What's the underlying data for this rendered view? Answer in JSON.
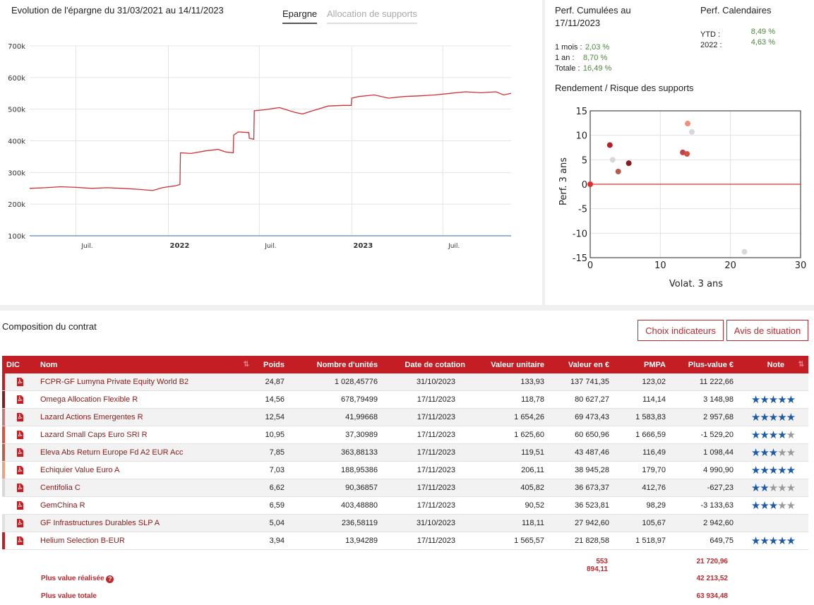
{
  "evolution": {
    "title": "Evolution de l'épargne du 31/03/2021 au 14/11/2023",
    "tabs": [
      {
        "label": "Epargne",
        "active": true
      },
      {
        "label": "Allocation de supports",
        "active": false
      }
    ],
    "chart_data": {
      "type": "line",
      "title": "",
      "y_ticks": [
        "100k",
        "200k",
        "300k",
        "400k",
        "500k",
        "600k",
        "700k"
      ],
      "x_ticks": [
        "Juil.",
        "2022",
        "Juil.",
        "2023",
        "Juil."
      ],
      "ylim": [
        100000,
        700000
      ],
      "xlim": [
        "2021-03-31",
        "2023-11-14"
      ],
      "color": "#d0303a",
      "series": [
        {
          "x": [
            "2021-03-31",
            "2021-05-01",
            "2021-06-01",
            "2021-07-01",
            "2021-08-01",
            "2021-09-01",
            "2021-10-01",
            "2021-11-01",
            "2021-12-01",
            "2021-12-20",
            "2022-01-01",
            "2022-01-15",
            "2022-01-24",
            "2022-01-25",
            "2022-02-15",
            "2022-03-15",
            "2022-04-10",
            "2022-04-25",
            "2022-05-10",
            "2022-05-11",
            "2022-05-20",
            "2022-06-10",
            "2022-06-11",
            "2022-06-20",
            "2022-06-21",
            "2022-07-10",
            "2022-08-10",
            "2022-09-10",
            "2022-09-25",
            "2022-10-15",
            "2022-11-15",
            "2022-12-15",
            "2022-12-31",
            "2023-01-01",
            "2023-01-15",
            "2023-02-15",
            "2023-03-15",
            "2023-04-15",
            "2023-05-15",
            "2023-06-15",
            "2023-07-15",
            "2023-08-15",
            "2023-09-15",
            "2023-10-15",
            "2023-10-30",
            "2023-11-14"
          ],
          "y": [
            250000,
            252000,
            255000,
            253000,
            250000,
            252000,
            250000,
            247000,
            243000,
            252000,
            255000,
            258000,
            262000,
            362000,
            360000,
            368000,
            373000,
            365000,
            362000,
            418000,
            428000,
            426000,
            408000,
            405000,
            495000,
            498000,
            505000,
            490000,
            485000,
            495000,
            510000,
            512000,
            512000,
            535000,
            540000,
            545000,
            535000,
            540000,
            542000,
            545000,
            550000,
            555000,
            552000,
            555000,
            545000,
            550000
          ]
        }
      ]
    }
  },
  "perf": {
    "cumul_title_line1": "Perf. Cumulées au",
    "cumul_title_line2": "17/11/2023",
    "rows": [
      {
        "label": "1 mois :",
        "value": "2,03 %"
      },
      {
        "label": "1 an :",
        "value": "8,70 %"
      },
      {
        "label": "Totale :",
        "value": "16,49 %"
      }
    ],
    "cal_title": "Perf. Calendaires",
    "cal_rows": [
      {
        "label": "YTD :",
        "value": "8,49 %"
      },
      {
        "label": "2022 :",
        "value": "4,63 %"
      }
    ]
  },
  "risk": {
    "title": "Rendement / Risque des supports",
    "chart_data": {
      "type": "scatter",
      "xlabel": "Volat. 3 ans",
      "ylabel": "Perf. 3 ans",
      "xlim": [
        0,
        30
      ],
      "ylim": [
        -15,
        15
      ],
      "x_ticks": [
        "0",
        "10",
        "20",
        "30"
      ],
      "y_ticks": [
        "15",
        "10",
        "5",
        "0",
        "-5",
        "-10",
        "-15"
      ],
      "points": [
        {
          "x": 2.8,
          "y": 8.0,
          "color": "#b5202a"
        },
        {
          "x": 3.2,
          "y": 5.0,
          "color": "#d8d8d8"
        },
        {
          "x": 4.0,
          "y": 2.6,
          "color": "#b85a4a"
        },
        {
          "x": 5.5,
          "y": 4.3,
          "color": "#8a1a22"
        },
        {
          "x": 13.2,
          "y": 6.5,
          "color": "#c0424a"
        },
        {
          "x": 13.8,
          "y": 6.2,
          "color": "#d25040"
        },
        {
          "x": 13.9,
          "y": 12.4,
          "color": "#f0907a"
        },
        {
          "x": 14.5,
          "y": 10.7,
          "color": "#d8d8d8"
        },
        {
          "x": 22.0,
          "y": -13.8,
          "color": "#d8d8d8"
        },
        {
          "x": 0.0,
          "y": 0.0,
          "color": "#e03030"
        }
      ]
    }
  },
  "composition": {
    "title": "Composition du contrat",
    "buttons": {
      "indicators": "Choix indicateurs",
      "situation": "Avis de situation"
    },
    "headers": [
      "DIC",
      "Nom",
      "Poids",
      "Nombre d'unités",
      "Date de cotation",
      "Valeur unitaire",
      "Valeur en €",
      "PMPA",
      "Plus-value €",
      "Note"
    ],
    "rows": [
      {
        "bar": "#c41e24",
        "nom": "FCPR-GF Lumyna Private Equity World B2",
        "poids": "24,87",
        "unites": "1 028,45776",
        "date": "31/10/2023",
        "vu": "133,93",
        "valeur": "137 741,35",
        "pmpa": "123,02",
        "pv": "11 222,66",
        "stars": 0
      },
      {
        "bar": "#8a1a22",
        "nom": "Omega Allocation Flexible R",
        "poids": "14,56",
        "unites": "678,79499",
        "date": "17/11/2023",
        "vu": "118,78",
        "valeur": "80 627,27",
        "pmpa": "114,14",
        "pv": "3 148,98",
        "stars": 5
      },
      {
        "bar": "#c47a7a",
        "nom": "Lazard Actions Emergentes R",
        "poids": "12,54",
        "unites": "41,99668",
        "date": "17/11/2023",
        "vu": "1 654,26",
        "valeur": "69 473,43",
        "pmpa": "1 583,83",
        "pv": "2 957,68",
        "stars": 5
      },
      {
        "bar": "#e0503a",
        "nom": "Lazard Small Caps Euro SRI R",
        "poids": "10,95",
        "unites": "37,30989",
        "date": "17/11/2023",
        "vu": "1 625,60",
        "valeur": "60 650,96",
        "pmpa": "1 666,59",
        "pv": "-1 529,20",
        "stars": 4
      },
      {
        "bar": "#b8604a",
        "nom": "Eleva Abs Return Europe Fd A2 EUR Acc",
        "poids": "7,85",
        "unites": "363,88133",
        "date": "17/11/2023",
        "vu": "119,51",
        "valeur": "43 487,46",
        "pmpa": "116,49",
        "pv": "1 098,44",
        "stars": 3
      },
      {
        "bar": "#f0a080",
        "nom": "Echiquier Value Euro A",
        "poids": "7,03",
        "unites": "188,95386",
        "date": "17/11/2023",
        "vu": "206,11",
        "valeur": "38 945,28",
        "pmpa": "179,70",
        "pv": "4 990,90",
        "stars": 5
      },
      {
        "bar": "#d8d8d8",
        "nom": "Centifolia C",
        "poids": "6,62",
        "unites": "90,36857",
        "date": "17/11/2023",
        "vu": "405,82",
        "valeur": "36 673,37",
        "pmpa": "412,76",
        "pv": "-627,23",
        "stars": 2
      },
      {
        "bar": "#ffffff",
        "nom": "GemChina R",
        "poids": "6,59",
        "unites": "403,48880",
        "date": "17/11/2023",
        "vu": "90,52",
        "valeur": "36 523,81",
        "pmpa": "98,29",
        "pv": "-3 133,63",
        "stars": 3
      },
      {
        "bar": "#e0e0e0",
        "nom": "GF Infrastructures Durables SLP A",
        "poids": "5,04",
        "unites": "236,58119",
        "date": "31/10/2023",
        "vu": "118,11",
        "valeur": "27 942,60",
        "pmpa": "105,67",
        "pv": "2 942,60",
        "stars": 0
      },
      {
        "bar": "#c41e24",
        "nom": "Helium Selection B-EUR",
        "poids": "3,94",
        "unites": "13,94289",
        "date": "17/11/2023",
        "vu": "1 565,57",
        "valeur": "21 828,58",
        "pmpa": "1 518,97",
        "pv": "649,75",
        "stars": 5
      }
    ],
    "totals": {
      "valeur": "553 894,11",
      "pv": "21 720,96",
      "realisee_label": "Plus value réalisée",
      "realisee": "42 213,52",
      "totale_label": "Plus value totale",
      "totale": "63 934,48"
    }
  }
}
